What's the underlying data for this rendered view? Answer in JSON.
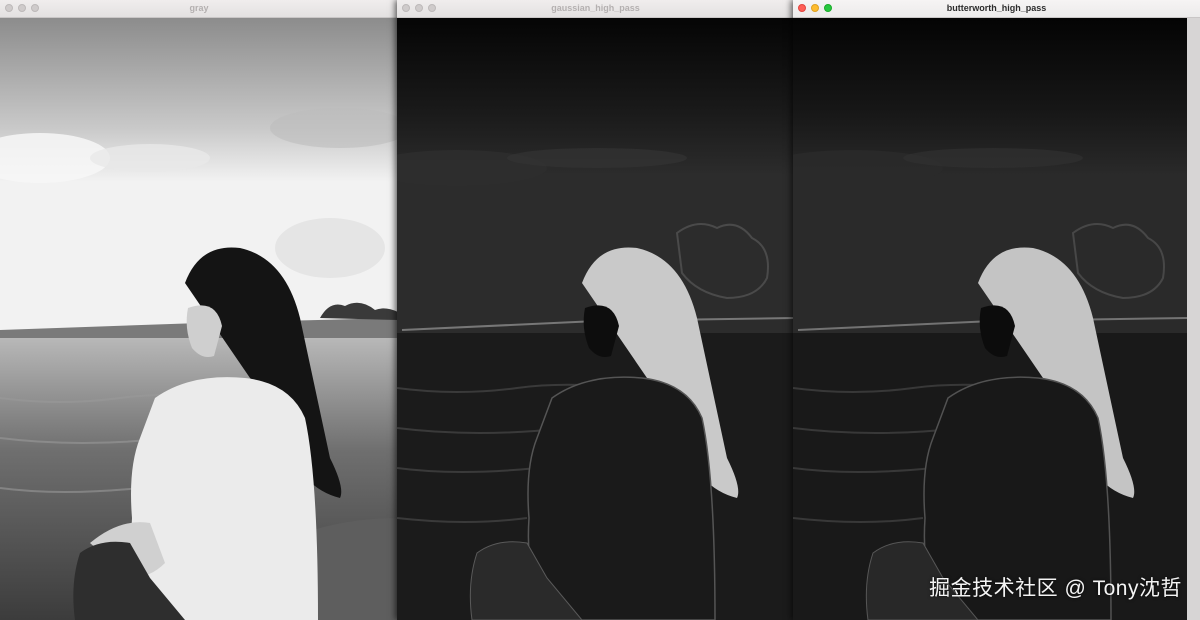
{
  "windows": [
    {
      "title": "gray",
      "image": "grayscale photo of a long-haired girl in a white shirt sitting by the sea"
    },
    {
      "title": "gaussian_high_pass",
      "image": "gaussian high pass filtered result"
    },
    {
      "title": "butterworth_high_pass",
      "image": "butterworth high pass filtered result"
    }
  ],
  "watermark": "掘金技术社区 @ Tony沈哲",
  "colors": {
    "titlebar": "#ebe8e8",
    "close": "#fe5f57",
    "minimize": "#febc2e",
    "zoom": "#28c840"
  }
}
